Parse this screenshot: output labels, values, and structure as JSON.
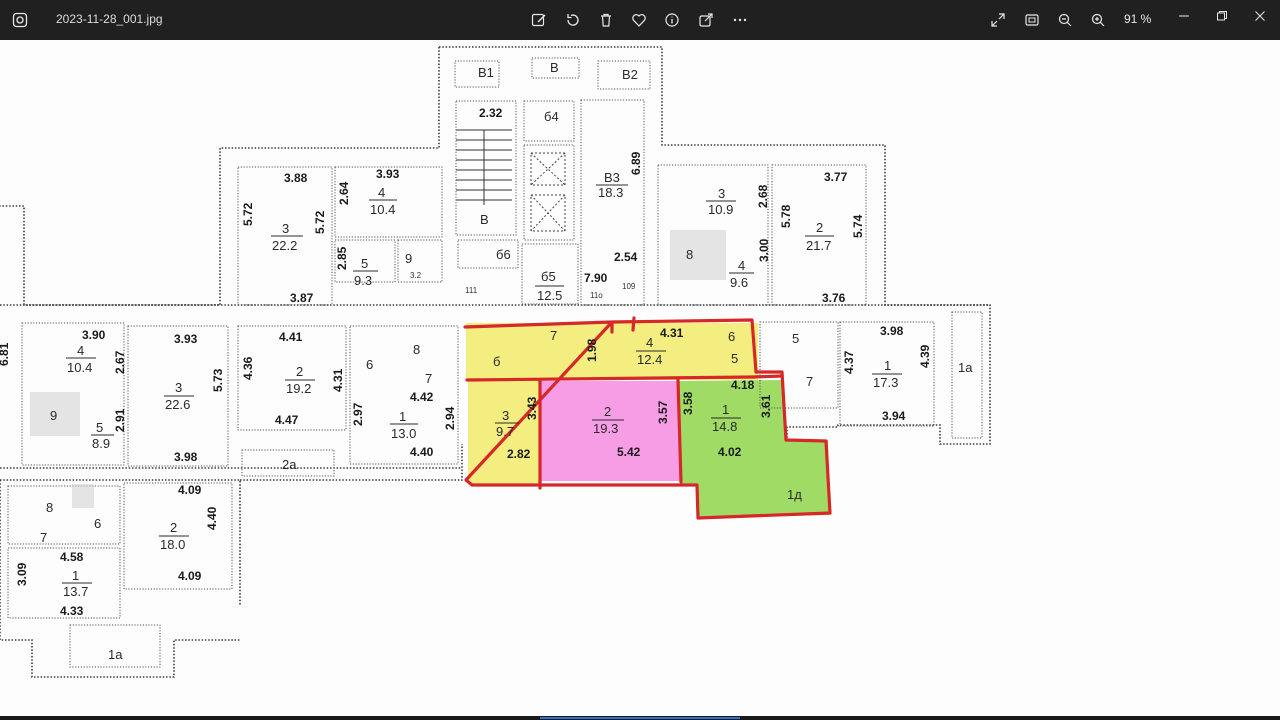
{
  "titlebar": {
    "file_name": "2023-11-28_001.jpg",
    "zoom_level": "91 %",
    "icons": {
      "app": "photos-app-icon",
      "edit": "edit-image-icon",
      "rotate": "rotate-icon",
      "delete": "trash-icon",
      "favorite": "heart-icon",
      "info": "info-icon",
      "share": "share-icon",
      "more": "more-dots-icon",
      "fullscreen": "fullscreen-icon",
      "fit": "fit-to-window-icon",
      "zoom_out": "zoom-out-icon",
      "zoom_in": "zoom-in-icon",
      "minimize": "minimize-icon",
      "maximize": "restore-icon",
      "close": "close-icon"
    }
  },
  "floorplan": {
    "highlight_colors": {
      "yellow": "#f2ea6a",
      "pink": "#f58ce0",
      "green": "#8fd64a",
      "outline": "#d62828"
    },
    "rooms": [
      {
        "id": "r-b1",
        "num": "В1",
        "area": "",
        "label": "В1"
      },
      {
        "id": "r-b",
        "num": "В",
        "area": "",
        "label": "В"
      },
      {
        "id": "r-b2",
        "num": "В2",
        "area": "",
        "label": "В2"
      },
      {
        "id": "r-top3",
        "num": "3",
        "area": "22.2"
      },
      {
        "id": "r-top4",
        "num": "4",
        "area": "10.4"
      },
      {
        "id": "r-top5",
        "num": "5",
        "area": "9.3"
      },
      {
        "id": "r-top9",
        "num": "9",
        "area": "3.2"
      },
      {
        "id": "r-b3",
        "num": "В3",
        "area": "18.3"
      },
      {
        "id": "r-b5",
        "num": "б5",
        "area": "12.5"
      },
      {
        "id": "r-b6",
        "num": "б6",
        "area": ""
      },
      {
        "id": "r-tr3",
        "num": "3",
        "area": "10.9"
      },
      {
        "id": "r-tr2",
        "num": "2",
        "area": "21.7"
      },
      {
        "id": "r-tr4",
        "num": "4",
        "area": "9.6"
      },
      {
        "id": "r-l4",
        "num": "4",
        "area": "10.4"
      },
      {
        "id": "r-l3",
        "num": "3",
        "area": "22.6"
      },
      {
        "id": "r-l5",
        "num": "5",
        "area": "8.9"
      },
      {
        "id": "r-c2",
        "num": "2",
        "area": "19.2"
      },
      {
        "id": "r-c1",
        "num": "1",
        "area": "13.0"
      },
      {
        "id": "r-h4",
        "num": "4",
        "area": "12.4"
      },
      {
        "id": "r-h3",
        "num": "3",
        "area": "9.7"
      },
      {
        "id": "r-h2",
        "num": "2",
        "area": "19.3"
      },
      {
        "id": "r-h1",
        "num": "1",
        "area": "14.8"
      },
      {
        "id": "r-r1",
        "num": "1",
        "area": "17.3"
      },
      {
        "id": "r-bl2",
        "num": "2",
        "area": "18.0"
      },
      {
        "id": "r-bl1",
        "num": "1",
        "area": "13.7"
      }
    ],
    "labels": {
      "b1": "В1",
      "b": "В",
      "b2": "В2",
      "b_stair": "В",
      "b4": "б4",
      "b5": "б5",
      "b6": "б6",
      "b3": "В3",
      "d_232": "2.32",
      "d_388": "3.88",
      "d_393a": "3.93",
      "d_264": "2.64",
      "d_572a": "5.72",
      "d_572b": "5.72",
      "d_285": "2.85",
      "d_387": "3.87",
      "d_689": "6.89",
      "d_254": "2.54",
      "d_790": "7.90",
      "d_377": "3.77",
      "d_268": "2.68",
      "d_578": "5.78",
      "d_574": "5.74",
      "d_300": "3.00",
      "d_376": "3.76",
      "d_390": "3.90",
      "d_393b": "3.93",
      "d_267": "2.67",
      "d_573": "5.73",
      "d_291": "2.91",
      "d_398a": "3.98",
      "d_441": "4.41",
      "d_436": "4.36",
      "d_431a": "4.31",
      "d_447": "4.47",
      "d_442": "4.42",
      "d_297": "2.97",
      "d_294": "2.94",
      "d_440a": "4.40",
      "d_198": "1.98",
      "d_431b": "4.31",
      "d_343": "3.43",
      "d_357": "3.57",
      "d_358": "3.58",
      "d_361": "3.61",
      "d_418": "4.18",
      "d_282": "2.82",
      "d_542": "5.42",
      "d_402": "4.02",
      "d_398b": "3.98",
      "d_437": "4.37",
      "d_439": "4.39",
      "d_394": "3.94",
      "d_409a": "4.09",
      "d_440b": "4.40",
      "d_409b": "4.09",
      "d_458": "4.58",
      "d_309": "3.09",
      "d_433": "4.33",
      "d_681": "6.81",
      "n_2a": "2а",
      "n_1a_right": "1а",
      "n_1a_bottom": "1а",
      "n_1d": "1д",
      "n_6a": "6",
      "n_7a": "7",
      "n_8a": "8",
      "n_6b": "б",
      "n_5b": "5",
      "n_7b": "7",
      "n_5c": "5",
      "n_8b": "8",
      "n_6c": "6",
      "n_7c": "7",
      "n_8c": "8",
      "n_9a": "9",
      "n_9b": "9",
      "n_8d": "8",
      "n_111": "111",
      "n_109": "109",
      "n_110": "11о"
    }
  }
}
